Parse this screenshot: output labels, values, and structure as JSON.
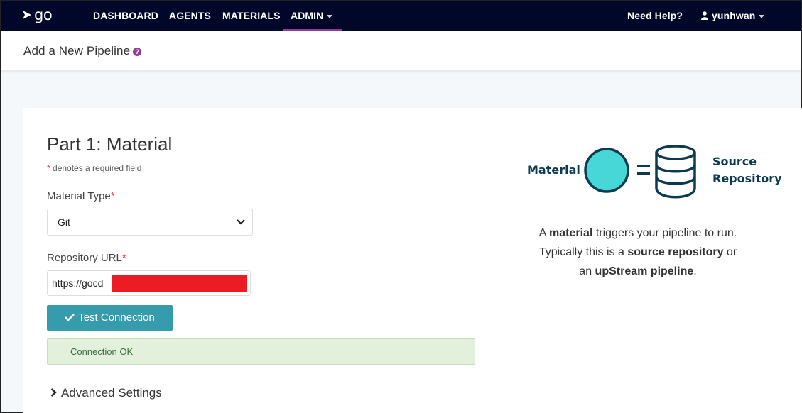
{
  "brand": {
    "logo_text": "go"
  },
  "nav": {
    "items": [
      {
        "label": "DASHBOARD"
      },
      {
        "label": "AGENTS"
      },
      {
        "label": "MATERIALS"
      },
      {
        "label": "ADMIN"
      }
    ],
    "help_label": "Need Help?",
    "user_label": "yunhwan"
  },
  "header": {
    "title": "Add a New Pipeline",
    "help_icon": "question-circle-icon"
  },
  "form": {
    "section_title": "Part 1: Material",
    "required_marker": "*",
    "required_note": "denotes a required field",
    "material_type": {
      "label": "Material Type",
      "value": "Git"
    },
    "repository_url": {
      "label": "Repository URL",
      "value": "https://gocd"
    },
    "test_button_label": "Test Connection",
    "status_message": "Connection OK",
    "advanced_label": "Advanced Settings"
  },
  "diagram": {
    "left_label": "Material",
    "right_label_line1": "Source",
    "right_label_line2": "Repository"
  },
  "explanation": {
    "p1": "A ",
    "b1": "material",
    "p2": " triggers your pipeline to run.",
    "p3": "Typically this is a ",
    "b2": "source repository",
    "p4": " or",
    "p5": "an ",
    "b3": "upStream pipeline",
    "p6": "."
  },
  "colors": {
    "nav_bg": "#000728",
    "accent": "#943a9e",
    "button": "#369bab",
    "success_bg": "#e2f0dc",
    "diagram_circle": "#47d7d7",
    "diagram_stroke": "#0b3a52"
  }
}
